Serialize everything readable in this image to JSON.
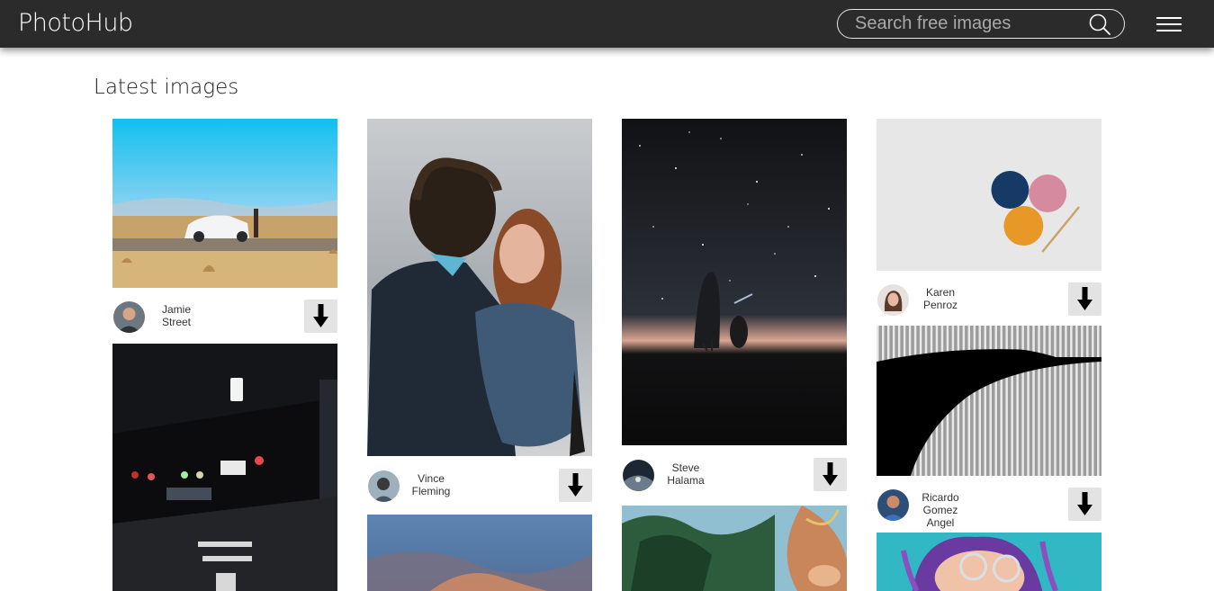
{
  "header": {
    "brand": "PhotoHub",
    "search_placeholder": "Search free images",
    "search_value": "",
    "search_icon": "search-icon",
    "menu_icon": "hamburger-menu-icon"
  },
  "main": {
    "section_title": "Latest images",
    "download_icon": "download-arrow-icon",
    "columns": [
      [
        {
          "subject": "white car on desert road",
          "author": "Jamie Street"
        },
        {
          "subject": "night street with blurred lights",
          "author": ""
        }
      ],
      [
        {
          "subject": "couple embracing by the sea",
          "author": "Vince Fleming"
        },
        {
          "subject": "dusk sky with clouds",
          "author": ""
        }
      ],
      [
        {
          "subject": "night sky with stars and comet",
          "author": "Steve Halama"
        },
        {
          "subject": "outdoor scene with pottery",
          "author": ""
        }
      ],
      [
        {
          "subject": "three balls of yarn with crochet hook",
          "author": "Karen Penroz"
        },
        {
          "subject": "black and white architecture",
          "author": "Ricardo Gomez Angel"
        },
        {
          "subject": "woman with purple braids and glasses",
          "author": ""
        }
      ]
    ]
  }
}
